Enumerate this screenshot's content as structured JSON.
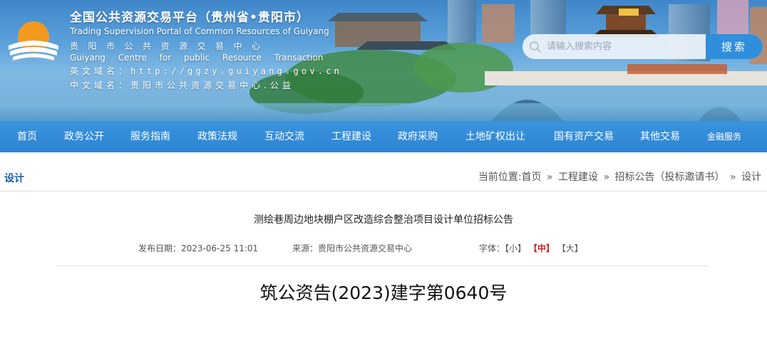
{
  "header": {
    "title_cn": "全国公共资源交易平台（贵州省•贵阳市）",
    "title_en": "Trading Supervision Portal of Common Resources of Guiyang",
    "center_cn": "贵阳市公共资源交易中心",
    "center_en": "Guiyang Centre for public Resource Transaction",
    "domain_en_label": "英文域名：",
    "domain_en_value": "http://ggzy.guiyang.gov.cn",
    "domain_cn_label": "中文域名：",
    "domain_cn_value": "贵阳市公共资源交易中心.公益"
  },
  "search": {
    "placeholder": "请输入搜索内容",
    "button_label": "搜索",
    "icon": "search-icon"
  },
  "nav": {
    "items": [
      {
        "label": "首页"
      },
      {
        "label": "政务公开"
      },
      {
        "label": "服务指南"
      },
      {
        "label": "政策法规"
      },
      {
        "label": "互动交流"
      },
      {
        "label": "工程建设"
      },
      {
        "label": "政府采购"
      },
      {
        "label": "土地矿权出让"
      },
      {
        "label": "国有资产交易"
      },
      {
        "label": "其他交易"
      },
      {
        "label": "金融服务"
      }
    ]
  },
  "page": {
    "section_title": "设计",
    "breadcrumb": {
      "prefix": "当前位置:",
      "items": [
        "首页",
        "工程建设",
        "招标公告（投标邀请书）",
        "设计"
      ],
      "separator": "»"
    }
  },
  "article": {
    "title": "测绘巷周边地块棚户区改造综合整治项目设计单位招标公告",
    "publish_label": "发布日期：",
    "publish_date": "2023-06-25 11:01",
    "source_label": "来源：",
    "source": "贵阳市公共资源交易中心",
    "font_label": "字体：",
    "font_options": [
      "【小】",
      "【中】",
      "【大】"
    ],
    "font_active": "【中】",
    "doc_number": "筑公资告(2023)建字第0640号"
  },
  "colors": {
    "nav_bg": "#2d85d2",
    "section_title": "#1a5fa8",
    "active_font": "#d01c1c",
    "search_button": "#2f8fdc"
  }
}
